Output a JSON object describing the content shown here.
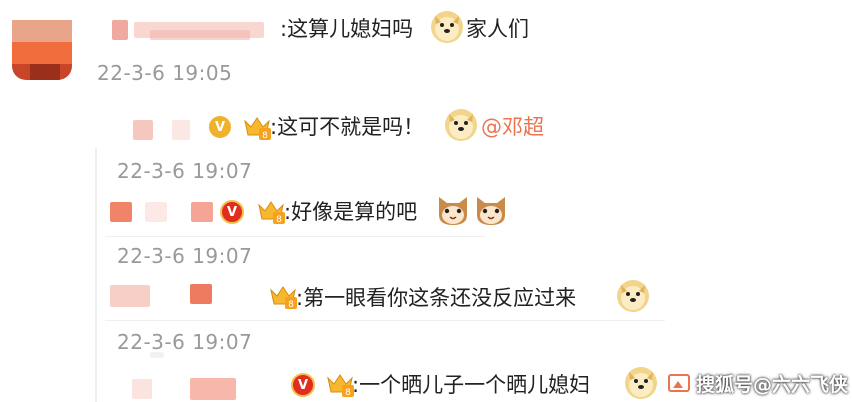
{
  "main_comment": {
    "text": ":这算儿媳妇吗",
    "text_suffix": "家人们",
    "time": "22-3-6 19:05"
  },
  "replies": [
    {
      "text": ":这可不就是吗！",
      "mention": "@邓超",
      "time": "22-3-6 19:07"
    },
    {
      "text": ":好像是算的吧",
      "time": "22-3-6 19:07"
    },
    {
      "text": ":第一眼看你这条还没反应过来",
      "time": "22-3-6 19:07"
    },
    {
      "text": ":一个晒儿子一个晒儿媳妇"
    }
  ],
  "badges": {
    "v": "V"
  },
  "watermark": "搜狐号@六六飞侠",
  "colors": {
    "mention": "#eb7350",
    "timestamp": "#999999",
    "accent_red": "#e02d20",
    "gold": "#f0b12b"
  }
}
